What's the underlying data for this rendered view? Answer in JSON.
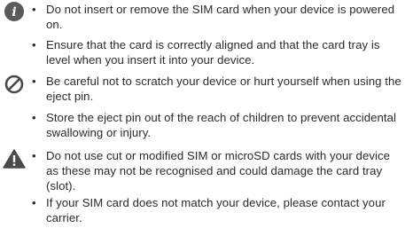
{
  "notes": [
    {
      "icon": "info-icon",
      "bullets": [
        "Do not insert or remove the SIM card when your device is powered on.",
        "Ensure that the card is correctly aligned and that the card tray is level when you insert it into your device."
      ]
    },
    {
      "icon": "prohibited-icon",
      "bullets": [
        "Be careful not to scratch your device or hurt yourself when using the eject pin.",
        "Store the eject pin out of the reach of children to prevent accidental swallowing or injury."
      ]
    },
    {
      "icon": "warning-icon",
      "bullets": [
        "Do not use cut or modified SIM or microSD cards with your device as these may not be recognised and could damage the card tray (slot).",
        "If your SIM card does not match your device, please contact your carrier."
      ]
    }
  ],
  "bullet_char": "•"
}
